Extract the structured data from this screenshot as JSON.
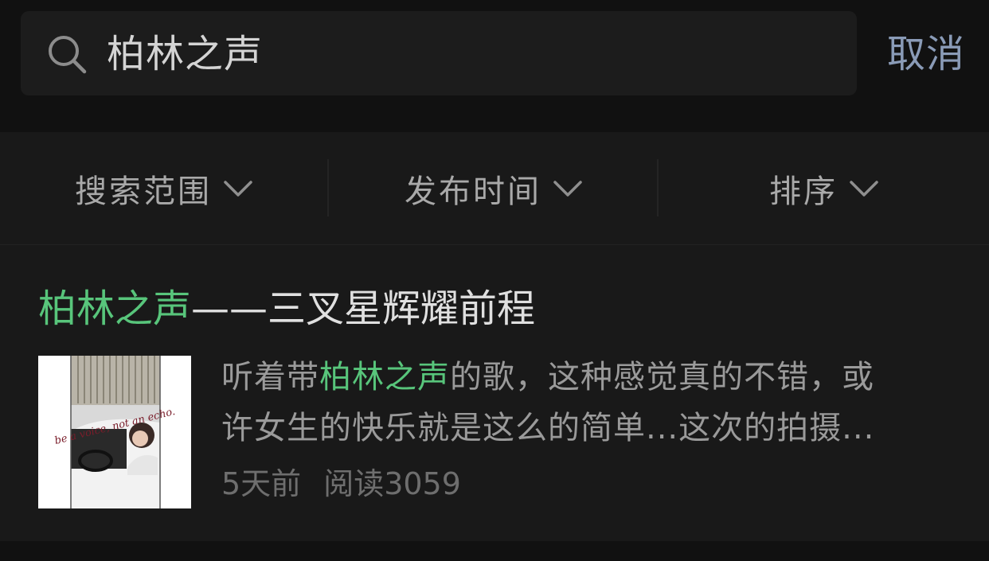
{
  "search": {
    "query": "柏林之声",
    "cancel_label": "取消"
  },
  "filters": [
    {
      "label": "搜索范围"
    },
    {
      "label": "发布时间"
    },
    {
      "label": "排序"
    }
  ],
  "result": {
    "title_highlight": "柏林之声",
    "title_rest": "——三叉星辉耀前程",
    "snippet_line1_pre": "听着带",
    "snippet_line1_highlight": "柏林之声",
    "snippet_line1_post": "的歌，这种感觉真的不错，或",
    "snippet_line2": "许女生的快乐就是这么的简单...这次的拍摄...",
    "time": "5天前",
    "reads": "阅读3059",
    "thumbnail_caption": "be a voice, not an echo."
  },
  "colors": {
    "background": "#111111",
    "panel": "#191919",
    "highlight": "#58c57b",
    "cancel": "#8a9bb7"
  }
}
